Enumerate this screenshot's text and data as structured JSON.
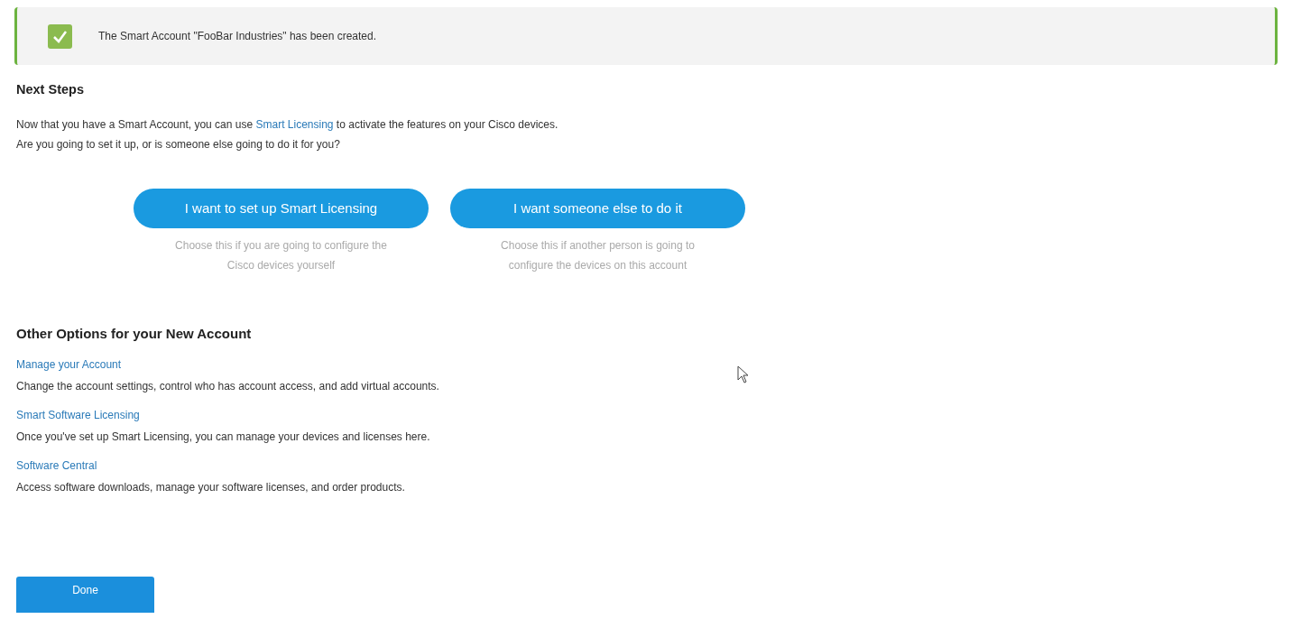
{
  "banner": {
    "message": "The Smart Account \"FooBar Industries\" has been created."
  },
  "next_steps": {
    "heading": "Next Steps",
    "intro": {
      "before": "Now that you have a Smart Account, you can use ",
      "link": "Smart Licensing",
      "after": " to activate the features on your Cisco devices."
    },
    "question": "Are you going to set it up, or is someone else going to do it for you?",
    "choices": [
      {
        "label": "I want to set up Smart Licensing",
        "caption": [
          "Choose this if you are going to configure the",
          "Cisco devices yourself"
        ]
      },
      {
        "label": "I want someone else to do it",
        "caption": [
          "Choose this if another person is going to",
          "configure the devices on this account"
        ]
      }
    ]
  },
  "other_options": {
    "heading": "Other Options for your New Account",
    "items": [
      {
        "link": "Manage your Account",
        "description": "Change the account settings, control who has account access, and add virtual accounts."
      },
      {
        "link": "Smart Software Licensing",
        "description": "Once you've set up Smart Licensing, you can manage your devices and licenses here."
      },
      {
        "link": "Software Central",
        "description": "Access software downloads, manage your software licenses, and order products."
      }
    ]
  },
  "done_button": "Done"
}
